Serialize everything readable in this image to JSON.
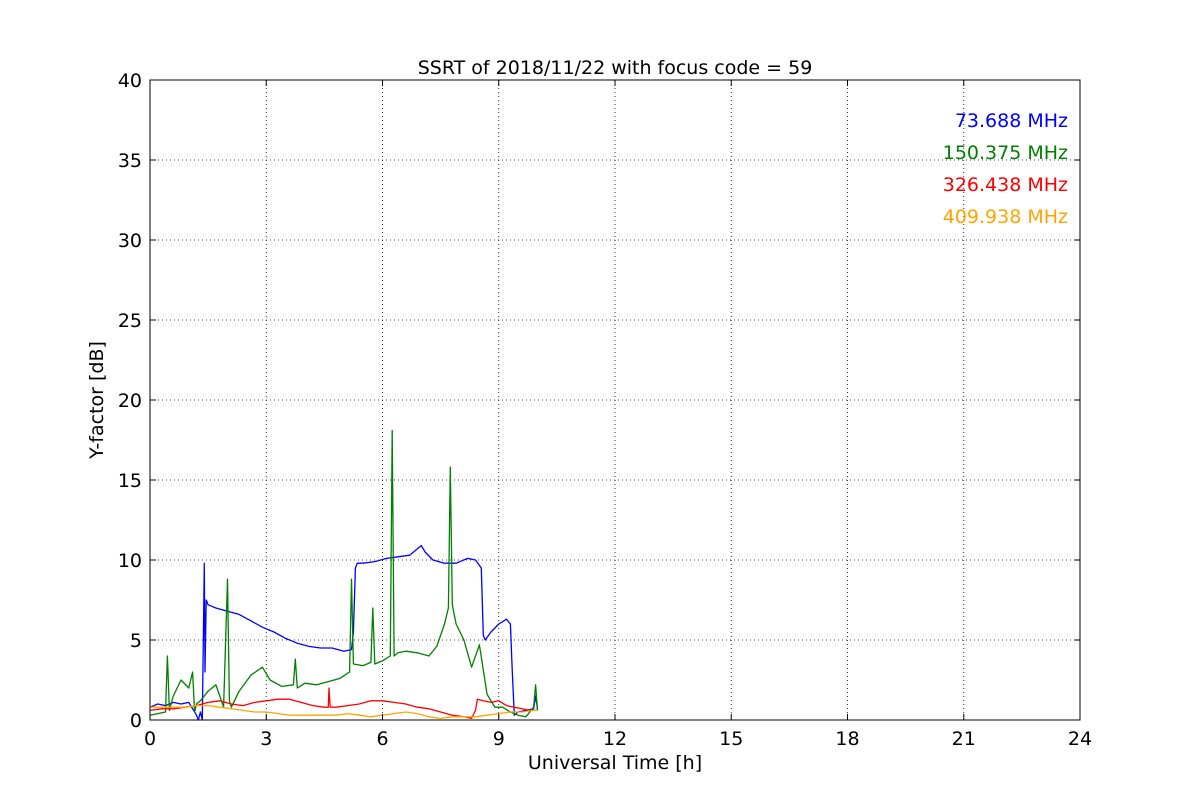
{
  "chart_data": {
    "type": "line",
    "title": "SSRT of 2018/11/22 with focus code = 59",
    "xlabel": "Universal Time [h]",
    "ylabel": "Y-factor [dB]",
    "xlim": [
      0,
      24
    ],
    "ylim": [
      0,
      40
    ],
    "x_ticks": [
      0,
      3,
      6,
      9,
      12,
      15,
      18,
      21,
      24
    ],
    "y_ticks": [
      0,
      5,
      10,
      15,
      20,
      25,
      30,
      35,
      40
    ],
    "grid": true,
    "legend_position": "top-right",
    "series": [
      {
        "name": "73.688 MHz",
        "color": "#0000ff",
        "x": [
          0,
          0.2,
          0.4,
          0.6,
          0.8,
          1.0,
          1.2,
          1.25,
          1.3,
          1.35,
          1.4,
          1.42,
          1.45,
          1.5,
          1.7,
          2.0,
          2.3,
          2.6,
          2.9,
          3.2,
          3.5,
          3.8,
          4.1,
          4.4,
          4.7,
          5.0,
          5.2,
          5.25,
          5.3,
          5.35,
          5.5,
          5.8,
          6.1,
          6.4,
          6.7,
          7.0,
          7.1,
          7.3,
          7.6,
          7.9,
          8.2,
          8.4,
          8.55,
          8.6,
          8.65,
          8.8,
          9.0,
          9.2,
          9.3,
          9.35,
          9.4,
          9.5,
          9.7,
          9.9,
          9.95,
          10.0
        ],
        "y": [
          0.8,
          1.0,
          0.9,
          1.1,
          1.0,
          1.1,
          0.3,
          0.0,
          0.5,
          0.0,
          9.8,
          3.0,
          7.5,
          7.2,
          7.0,
          6.8,
          6.6,
          6.2,
          5.8,
          5.5,
          5.1,
          4.8,
          4.6,
          4.5,
          4.5,
          4.3,
          4.4,
          5.5,
          9.5,
          9.8,
          9.8,
          9.9,
          10.1,
          10.2,
          10.3,
          10.9,
          10.5,
          10.0,
          9.8,
          9.8,
          10.1,
          10.0,
          9.5,
          5.3,
          5.0,
          5.5,
          6.0,
          6.3,
          6.0,
          3.0,
          0.3,
          0.5,
          0.6,
          0.7,
          1.5,
          0.7
        ]
      },
      {
        "name": "150.375 MHz",
        "color": "#008000",
        "x": [
          0,
          0.2,
          0.4,
          0.45,
          0.5,
          0.6,
          0.8,
          1.0,
          1.1,
          1.15,
          1.2,
          1.3,
          1.5,
          1.7,
          1.9,
          2.0,
          2.05,
          2.1,
          2.3,
          2.6,
          2.9,
          3.1,
          3.4,
          3.7,
          3.75,
          3.8,
          4.0,
          4.3,
          4.6,
          4.9,
          5.15,
          5.2,
          5.25,
          5.5,
          5.7,
          5.75,
          5.8,
          6.0,
          6.2,
          6.25,
          6.3,
          6.4,
          6.6,
          6.9,
          7.2,
          7.4,
          7.6,
          7.7,
          7.75,
          7.8,
          7.9,
          8.1,
          8.3,
          8.5,
          8.7,
          8.9,
          9.1,
          9.3,
          9.5,
          9.7,
          9.9,
          9.95,
          10.0
        ],
        "y": [
          0.3,
          0.4,
          0.5,
          4.0,
          0.6,
          1.5,
          2.5,
          2.0,
          3.0,
          0.5,
          1.0,
          1.2,
          1.8,
          2.2,
          0.8,
          8.8,
          1.2,
          0.8,
          1.8,
          2.8,
          3.3,
          2.5,
          2.1,
          2.2,
          3.8,
          2.0,
          2.3,
          2.2,
          2.4,
          2.6,
          3.0,
          8.8,
          3.5,
          3.4,
          3.6,
          7.0,
          3.5,
          3.7,
          4.0,
          18.1,
          4.0,
          4.2,
          4.3,
          4.2,
          4.0,
          4.6,
          6.0,
          7.0,
          15.8,
          7.2,
          6.0,
          5.0,
          3.3,
          4.7,
          1.6,
          0.8,
          0.8,
          0.5,
          0.3,
          0.2,
          0.8,
          2.2,
          0.6
        ]
      },
      {
        "name": "326.438 MHz",
        "color": "#ff0000",
        "x": [
          0,
          0.3,
          0.6,
          0.9,
          1.2,
          1.5,
          1.8,
          2.1,
          2.4,
          2.7,
          3.0,
          3.3,
          3.6,
          3.9,
          4.2,
          4.5,
          4.6,
          4.62,
          4.65,
          4.8,
          5.1,
          5.4,
          5.7,
          6.0,
          6.3,
          6.6,
          6.9,
          7.2,
          7.5,
          7.8,
          8.1,
          8.3,
          8.4,
          8.45,
          8.6,
          8.8,
          9.0,
          9.2,
          9.4,
          9.6,
          9.8,
          10.0
        ],
        "y": [
          0.6,
          0.7,
          0.7,
          0.8,
          0.9,
          1.1,
          1.2,
          1.0,
          0.9,
          1.1,
          1.2,
          1.3,
          1.3,
          1.1,
          0.9,
          0.8,
          0.8,
          2.0,
          0.8,
          0.8,
          0.9,
          1.0,
          1.2,
          1.2,
          1.1,
          1.0,
          0.8,
          0.7,
          0.5,
          0.3,
          0.2,
          0.1,
          0.6,
          1.3,
          1.2,
          1.1,
          1.2,
          0.9,
          0.8,
          0.7,
          0.6,
          0.6
        ]
      },
      {
        "name": "409.938 MHz",
        "color": "#ffa500",
        "x": [
          0,
          0.3,
          0.6,
          0.9,
          1.2,
          1.5,
          1.8,
          2.1,
          2.4,
          2.7,
          3.0,
          3.3,
          3.6,
          3.9,
          4.2,
          4.5,
          4.8,
          5.1,
          5.4,
          5.7,
          6.0,
          6.3,
          6.6,
          6.9,
          7.2,
          7.5,
          7.8,
          8.1,
          8.4,
          8.7,
          9.0,
          9.3,
          9.6,
          9.9,
          10.0
        ],
        "y": [
          0.8,
          0.8,
          0.8,
          0.8,
          0.9,
          0.9,
          0.8,
          0.7,
          0.6,
          0.5,
          0.5,
          0.4,
          0.3,
          0.3,
          0.3,
          0.3,
          0.3,
          0.4,
          0.3,
          0.2,
          0.3,
          0.4,
          0.5,
          0.4,
          0.2,
          0.1,
          0.2,
          0.2,
          0.2,
          0.3,
          0.4,
          0.5,
          0.5,
          0.6,
          0.6
        ]
      }
    ]
  }
}
